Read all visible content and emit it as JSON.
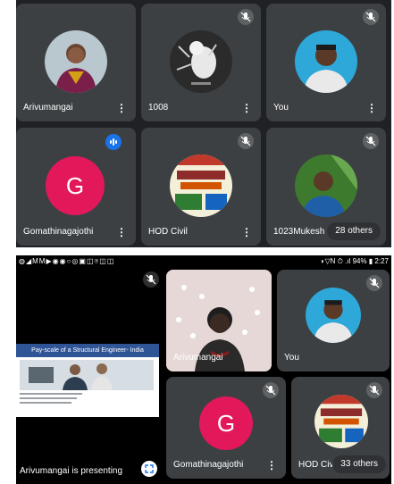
{
  "screenshot_1": {
    "tiles": [
      {
        "name": "Arivumangai"
      },
      {
        "name": "1008"
      },
      {
        "name": "You"
      },
      {
        "name": "Gomathinagajothi",
        "initial": "G"
      },
      {
        "name": "HOD Civil"
      },
      {
        "name": "1023Mukesh"
      }
    ],
    "others_badge": "28 others"
  },
  "screenshot_2": {
    "status_bar": {
      "left_icons": "◍◢MM▶◉◉○◎▣◫⌾◫◫",
      "right": "◗▽N ⏱ .ıl 94% ▮ 2:27"
    },
    "presentation": {
      "slide_title": "Pay-scale of a Structural Engineer- India",
      "label": "Arivumangai is presenting"
    },
    "tiles": [
      {
        "name": "Arivumangai"
      },
      {
        "name": "You"
      },
      {
        "name": "Gomathinagajothi",
        "initial": "G"
      },
      {
        "name": "HOD Civil"
      }
    ],
    "others_badge": "33 others"
  },
  "colors": {
    "tile_bg": "#3c4043",
    "avatar_letter_bg": "#e2185b",
    "speaking_indicator": "#1a73e8"
  }
}
